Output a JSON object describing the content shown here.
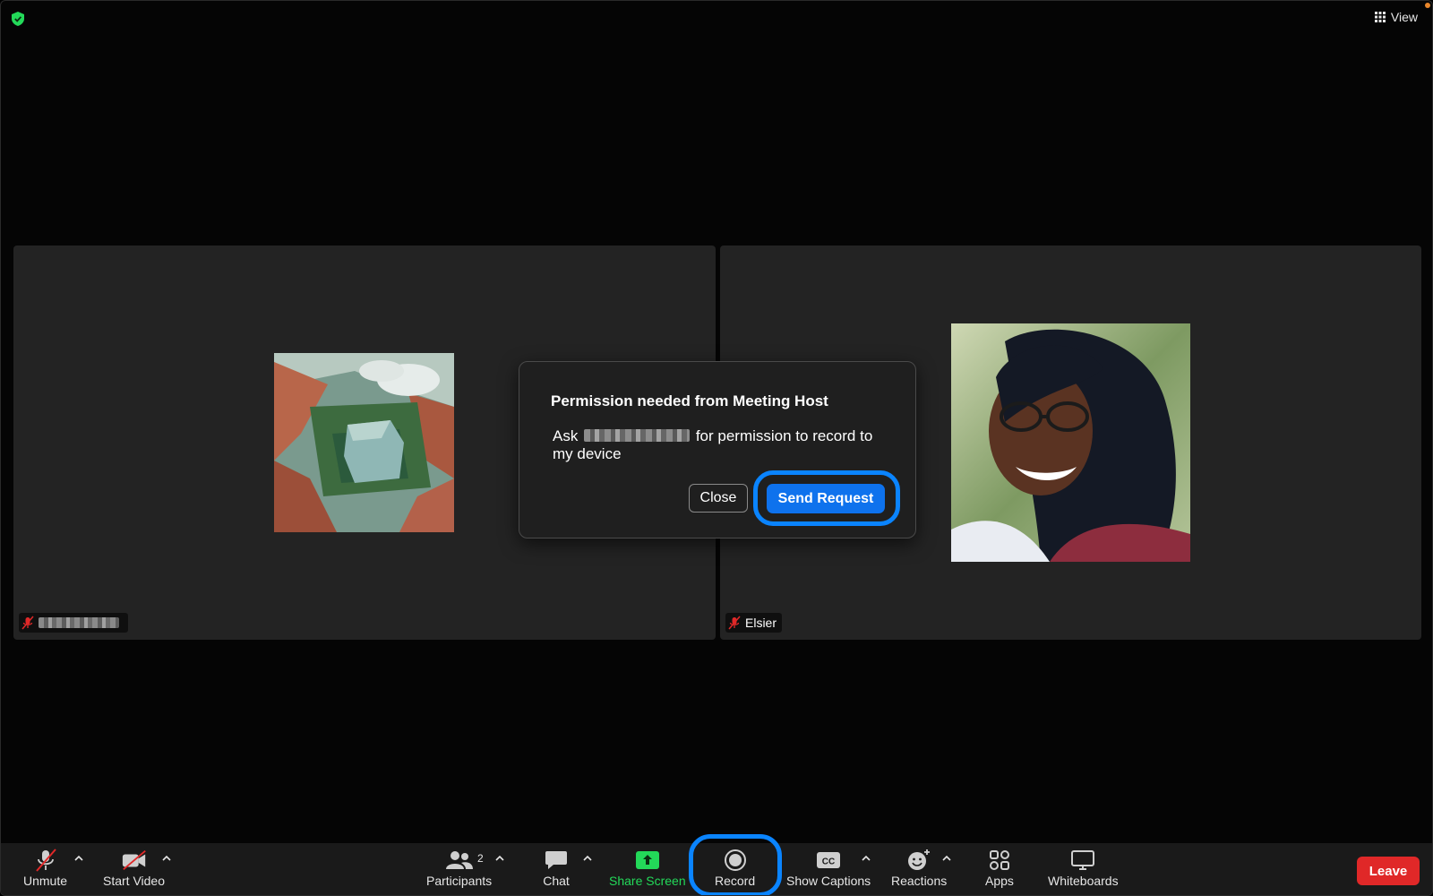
{
  "topbar": {
    "view_label": "View"
  },
  "tiles": {
    "left": {
      "name": ""
    },
    "right": {
      "name": "Elsier"
    }
  },
  "dialog": {
    "title": "Permission needed from Meeting Host",
    "body_prefix": "Ask",
    "body_suffix": "for permission to record to my device",
    "close_label": "Close",
    "send_label": "Send Request"
  },
  "toolbar": {
    "unmute": "Unmute",
    "start_video": "Start Video",
    "participants": "Participants",
    "participants_count": "2",
    "chat": "Chat",
    "share_screen": "Share Screen",
    "record": "Record",
    "show_captions": "Show Captions",
    "reactions": "Reactions",
    "apps": "Apps",
    "whiteboards": "Whiteboards",
    "leave": "Leave"
  },
  "colors": {
    "accent_blue": "#0e72ed",
    "highlight_ring": "#0a84ff",
    "share_green": "#23d959",
    "leave_red": "#e02828",
    "mute_red": "#e02828"
  }
}
